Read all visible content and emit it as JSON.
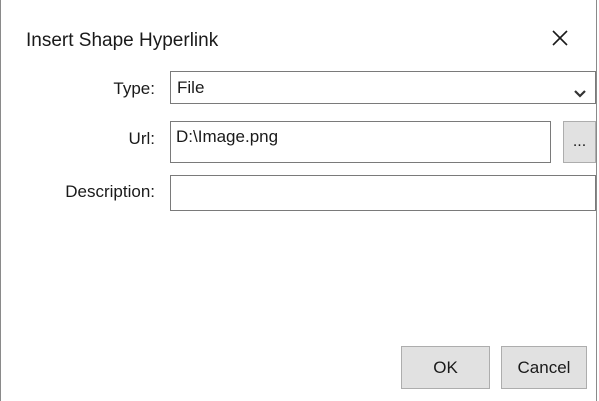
{
  "dialog": {
    "title": "Insert Shape Hyperlink",
    "close_icon": "close-icon"
  },
  "type_field": {
    "label": "Type:",
    "selected": "File",
    "dropdown_icon": "chevron-down-icon"
  },
  "url_field": {
    "label": "Url:",
    "value": "D:\\Image.png",
    "browse_label": "..."
  },
  "description_field": {
    "label": "Description:",
    "value": ""
  },
  "buttons": {
    "ok_label": "OK",
    "cancel_label": "Cancel"
  }
}
